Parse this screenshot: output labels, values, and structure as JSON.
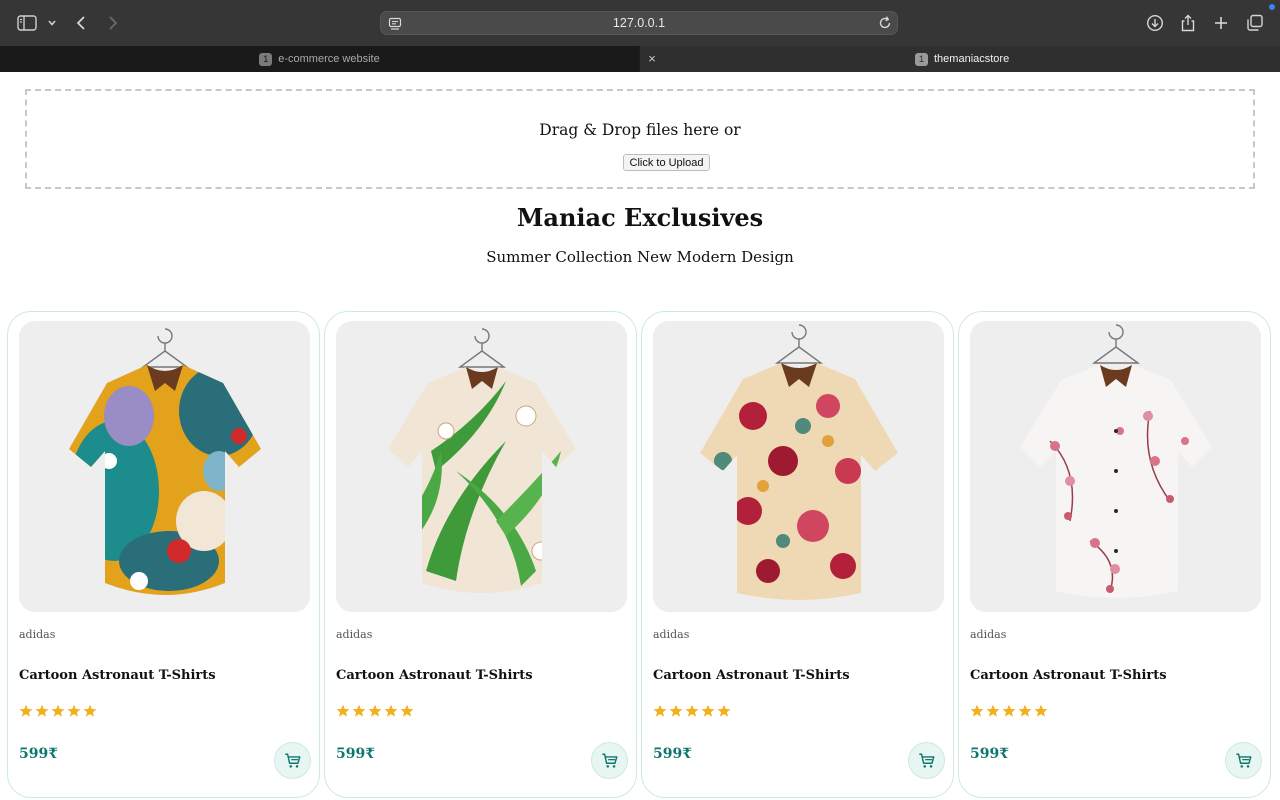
{
  "browser": {
    "url": "127.0.0.1",
    "tabs": [
      {
        "number": "1",
        "title": "e-commerce website",
        "active": false
      },
      {
        "number": "1",
        "title": "themaniacstore",
        "active": true
      }
    ],
    "close_tab_glyph": "×"
  },
  "upload": {
    "prompt": "Drag & Drop files here or",
    "button_label": "Click to Upload"
  },
  "header": {
    "title": "Maniac Exclusives",
    "subtitle": "Summer Collection New Modern Design"
  },
  "colors": {
    "price": "#0f766e",
    "star": "#f2b01e",
    "card_border": "#cfe9e2",
    "cart_button_bg": "#e7f6f2"
  },
  "products": [
    {
      "brand": "adidas",
      "name": "Cartoon Astronaut T-Shirts",
      "rating": 5,
      "price": "599₹",
      "image": "colorful-abstract-shirt"
    },
    {
      "brand": "adidas",
      "name": "Cartoon Astronaut T-Shirts",
      "rating": 5,
      "price": "599₹",
      "image": "green-leaf-floral-shirt"
    },
    {
      "brand": "adidas",
      "name": "Cartoon Astronaut T-Shirts",
      "rating": 5,
      "price": "599₹",
      "image": "red-rose-floral-shirt"
    },
    {
      "brand": "adidas",
      "name": "Cartoon Astronaut T-Shirts",
      "rating": 5,
      "price": "599₹",
      "image": "pink-blossom-white-shirt"
    }
  ]
}
